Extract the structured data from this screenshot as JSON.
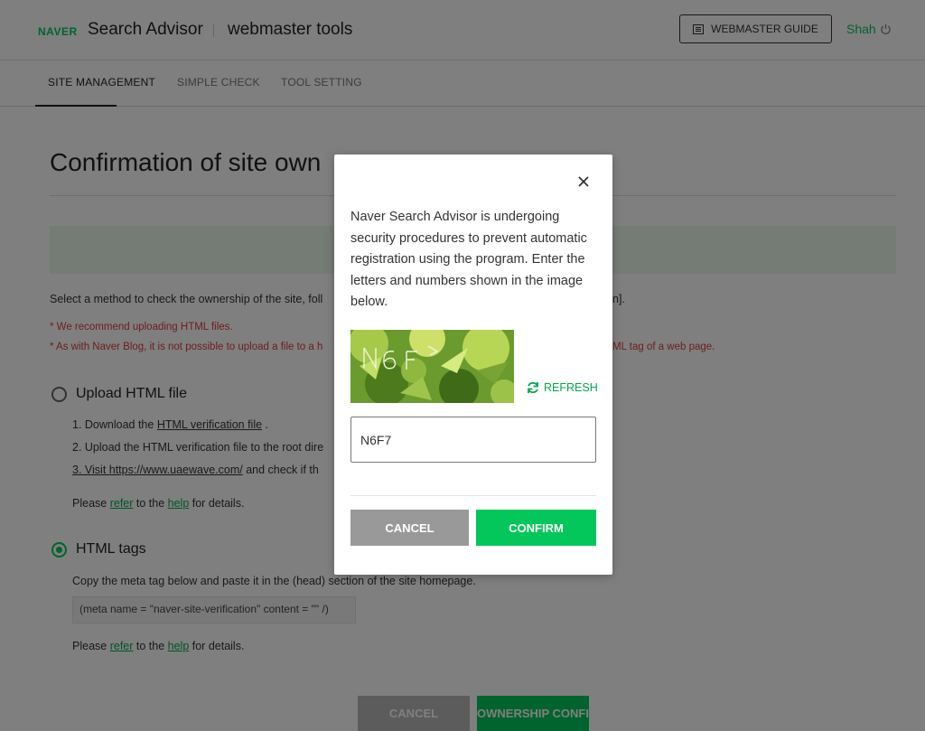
{
  "header": {
    "brand": "NAVER",
    "product": "Search Advisor",
    "section": "webmaster tools",
    "guide_button": "WEBMASTER GUIDE",
    "user": "Shah"
  },
  "nav": {
    "tabs": [
      {
        "label": "SITE MANAGEMENT",
        "active": true
      },
      {
        "label": "SIMPLE CHECK",
        "active": false
      },
      {
        "label": "TOOL SETTING",
        "active": false
      }
    ]
  },
  "page": {
    "title": "Confirmation of site own",
    "intro": "Select a method to check the ownership of the site, foll",
    "intro_tail": "n].",
    "warnings": [
      {
        "text": "* We recommend uploading HTML files.",
        "tail": ""
      },
      {
        "text": "* As with Naver Blog, it is not possible to upload a file to a h",
        "tail": "ML tag of a web page."
      }
    ],
    "methods": {
      "upload": {
        "label": "Upload HTML file",
        "step1_pre": "1. Download the ",
        "step1_link": "HTML verification file",
        "step1_post": " .",
        "step2": "2. Upload the HTML verification file to the root dire",
        "step3_link": "3. Visit https://www.uaewave.com/",
        "step3_post": " and check if th",
        "help_pre": "Please ",
        "help_refer": "refer",
        "help_mid": " to the ",
        "help_help": "help",
        "help_post": " for details."
      },
      "html_tags": {
        "label": "HTML tags",
        "description": "Copy the meta tag below and paste it in the (head) section of the site homepage.",
        "meta": "(meta name = \"naver-site-verification\" content = \"\" /)",
        "help_pre": "Please ",
        "help_refer": "refer",
        "help_mid": " to the ",
        "help_help": "help",
        "help_post": " for details."
      }
    },
    "buttons": {
      "cancel": "CANCEL",
      "confirm": "OWNERSHIP CONFIRMAT"
    }
  },
  "modal": {
    "message": "Naver Search Advisor is undergoing security procedures to prevent automatic registration using the program. Enter the letters and numbers shown in the image below.",
    "refresh": "REFRESH",
    "input_value": "N6F7",
    "cancel": "CANCEL",
    "confirm": "CONFIRM"
  },
  "colors": {
    "accent": "#03c75a",
    "warning": "#e0393e",
    "notice_band": "#eaf7ea"
  },
  "icons": [
    "book-icon",
    "power-icon",
    "close-icon",
    "refresh-icon",
    "radio-icon"
  ]
}
